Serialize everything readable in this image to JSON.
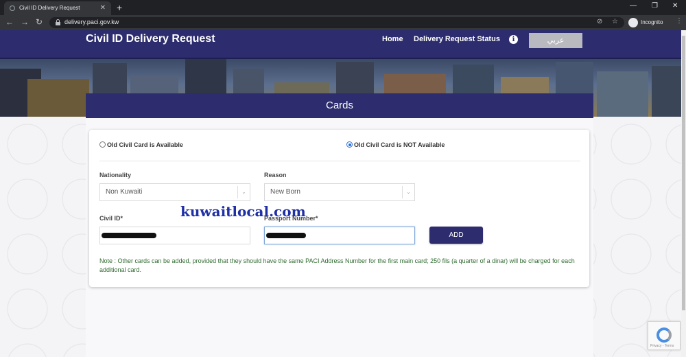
{
  "browser": {
    "tab_title": "Civil ID Delivery Request",
    "new_tab": "+",
    "url": "delivery.paci.gov.kw",
    "profile": "Incognito"
  },
  "header": {
    "site_title": "Civil ID Delivery Request",
    "nav": [
      "Home",
      "Delivery Request Status"
    ],
    "info": "i",
    "language_button": "عربي"
  },
  "cards": {
    "title": "Cards",
    "radio_options": [
      {
        "label": "Old Civil Card is Available",
        "selected": false
      },
      {
        "label": "Old Civil Card is NOT Available",
        "selected": true
      }
    ],
    "nationality": {
      "label": "Nationality",
      "value": "Non Kuwaiti"
    },
    "reason": {
      "label": "Reason",
      "value": "New Born"
    },
    "civil_id": {
      "label": "Civil ID*"
    },
    "passport": {
      "label": "Passport Number*"
    },
    "add_button": "ADD",
    "note": "Note : Other cards can be added, provided that they should have the same PACI Address Number for the first main card; 250 fils (a quarter of a dinar) will be charged for each additional card."
  },
  "watermark": "kuwaitlocal.com",
  "recaptcha": "Privacy - Terms",
  "colors": {
    "primary": "#2c2c6e",
    "note": "#2e6b2e",
    "watermark": "#1f2fa6"
  }
}
